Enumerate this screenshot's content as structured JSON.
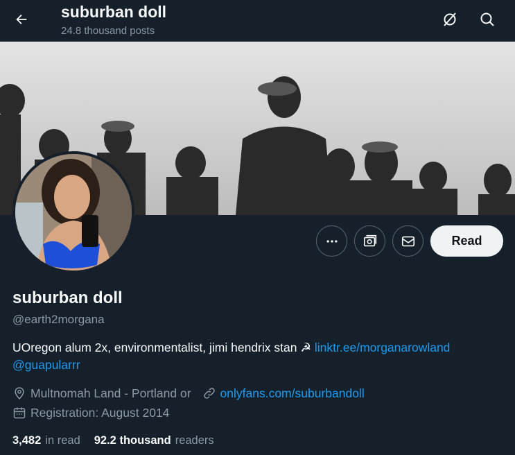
{
  "header": {
    "title": "suburban doll",
    "posts_count": "24.8 thousand posts"
  },
  "icons": {
    "back": "arrow-left-icon",
    "grok": "grok-icon",
    "search": "search-icon",
    "more": "more-dots-icon",
    "subscribe": "subscription-icon",
    "message": "envelope-icon",
    "location": "location-pin-icon",
    "link": "link-icon",
    "calendar": "calendar-icon"
  },
  "profile": {
    "name": "suburban doll",
    "handle": "@earth2morgana",
    "bio_text": "UOregon alum 2x, environmentalist, jimi hendrix stan ☭",
    "bio_link": "linktr.ee/morganarowland",
    "bio_mention": "@guapularrr",
    "location": "Multnomah Land - Portland or",
    "website": "onlyfans.com/suburbandoll",
    "joined": "Registration: August 2014",
    "following_count": "3,482",
    "following_label": "in read",
    "followers_count": "92.2 thousand",
    "followers_label": "readers"
  },
  "actions": {
    "follow_label": "Read"
  },
  "colors": {
    "background": "#15202b",
    "text_primary": "#f7f9f9",
    "text_secondary": "#8b98a5",
    "link": "#1d9bf0",
    "button_bg": "#eff3f4"
  }
}
